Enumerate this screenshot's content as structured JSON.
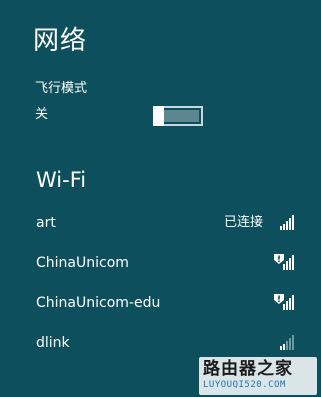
{
  "header": {
    "title": "网络"
  },
  "airplane_mode": {
    "label": "飞行模式",
    "state_label": "关",
    "enabled": false
  },
  "wifi": {
    "section_title": "Wi-Fi",
    "networks": [
      {
        "name": "art",
        "status": "已连接",
        "secured": false,
        "signal_bars": 5
      },
      {
        "name": "ChinaUnicom",
        "status": "",
        "secured": false,
        "warning": true,
        "signal_bars": 5
      },
      {
        "name": "ChinaUnicom-edu",
        "status": "",
        "secured": false,
        "warning": true,
        "signal_bars": 5
      },
      {
        "name": "dlink",
        "status": "",
        "secured": false,
        "signal_bars": 2
      }
    ]
  },
  "watermark": {
    "title": "路由器之家",
    "url": "LUYOUQI520.COM"
  },
  "colors": {
    "background": "#0d4f5c",
    "text": "#ffffff",
    "toggle_off_track": "#5c8690",
    "signal_dim": "#6f9aa3"
  }
}
